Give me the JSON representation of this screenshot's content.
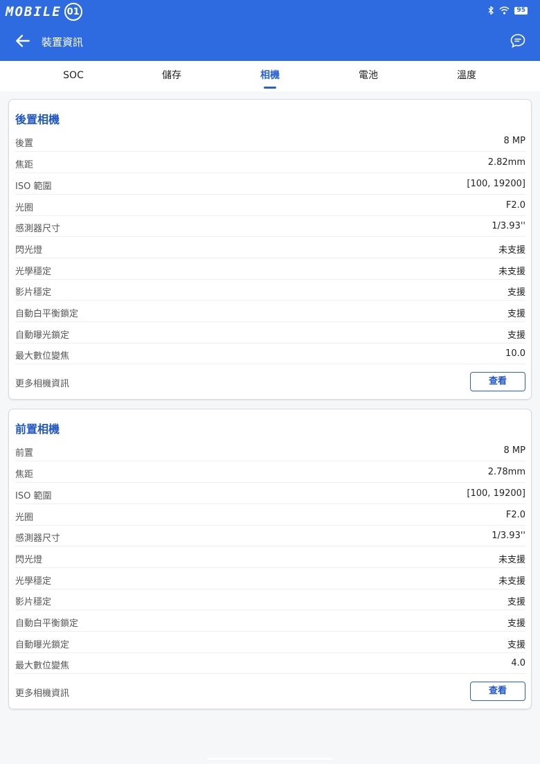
{
  "status": {
    "battery": "95",
    "logo_text": "MOBILE",
    "logo_suffix": "01"
  },
  "appbar": {
    "title": "裝置資訊"
  },
  "tabs": [
    {
      "label": "SOC"
    },
    {
      "label": "儲存"
    },
    {
      "label": "相機",
      "active": true
    },
    {
      "label": "電池"
    },
    {
      "label": "溫度"
    }
  ],
  "rear": {
    "title": "後置相機",
    "rows": [
      {
        "label": "後置",
        "value": "8 MP"
      },
      {
        "label": "焦距",
        "value": "2.82mm"
      },
      {
        "label": "ISO 範圍",
        "value": "[100, 19200]"
      },
      {
        "label": "光圈",
        "value": "F2.0"
      },
      {
        "label": "感測器尺寸",
        "value": "1/3.93''"
      },
      {
        "label": "閃光燈",
        "value": "未支援"
      },
      {
        "label": "光學穩定",
        "value": "未支援"
      },
      {
        "label": "影片穩定",
        "value": "支援"
      },
      {
        "label": "自動白平衡鎖定",
        "value": "支援"
      },
      {
        "label": "自動曝光鎖定",
        "value": "支援"
      },
      {
        "label": "最大數位變焦",
        "value": "10.0"
      }
    ],
    "more_label": "更多相機資訊",
    "button_label": "查看"
  },
  "front": {
    "title": "前置相機",
    "rows": [
      {
        "label": "前置",
        "value": "8 MP"
      },
      {
        "label": "焦距",
        "value": "2.78mm"
      },
      {
        "label": "ISO 範圍",
        "value": "[100, 19200]"
      },
      {
        "label": "光圈",
        "value": "F2.0"
      },
      {
        "label": "感測器尺寸",
        "value": "1/3.93''"
      },
      {
        "label": "閃光燈",
        "value": "未支援"
      },
      {
        "label": "光學穩定",
        "value": "未支援"
      },
      {
        "label": "影片穩定",
        "value": "支援"
      },
      {
        "label": "自動白平衡鎖定",
        "value": "支援"
      },
      {
        "label": "自動曝光鎖定",
        "value": "支援"
      },
      {
        "label": "最大數位變焦",
        "value": "4.0"
      }
    ],
    "more_label": "更多相機資訊",
    "button_label": "查看"
  },
  "colors": {
    "primary": "#2f6be0",
    "accent": "#2056c7",
    "background": "#f6f7f9"
  },
  "icons": [
    "back-arrow-icon",
    "chat-icon",
    "bluetooth-icon",
    "wifi-icon",
    "battery-icon"
  ]
}
